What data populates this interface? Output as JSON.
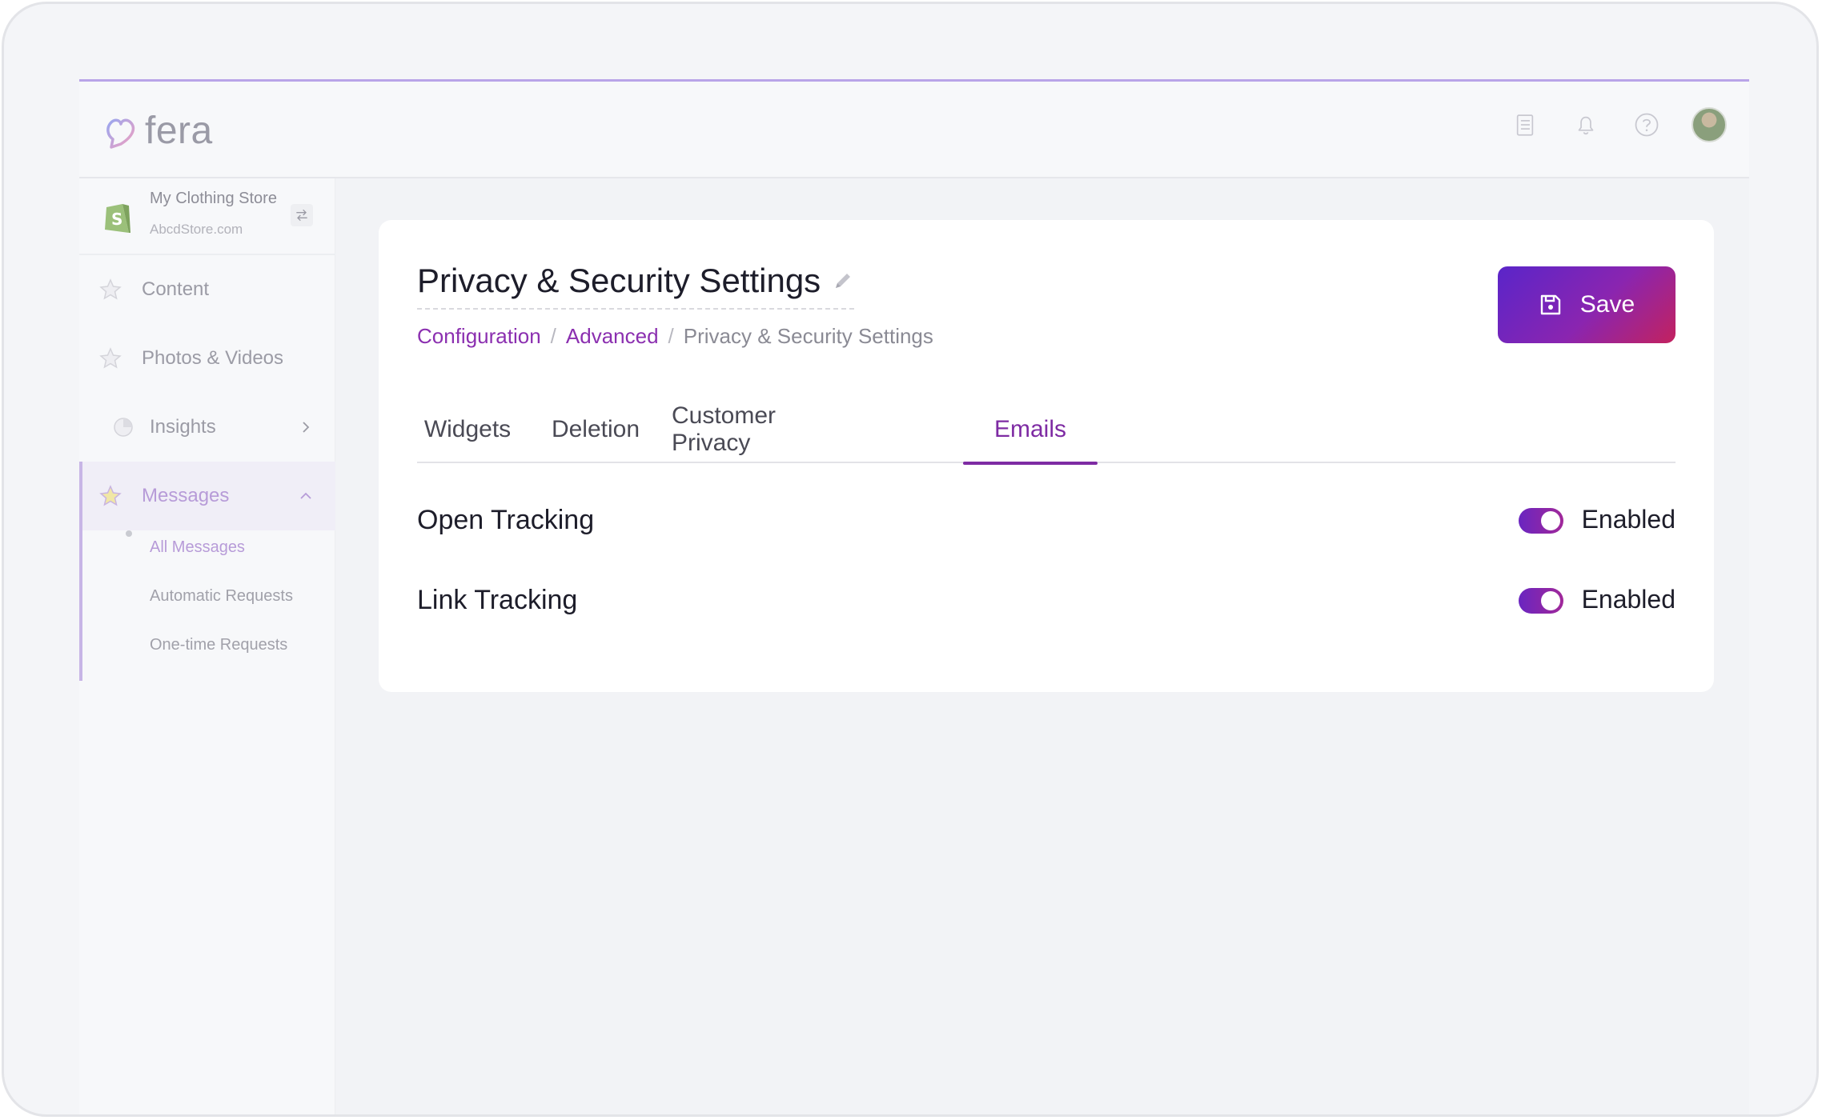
{
  "brand": {
    "name": "fera",
    "accent": "#8b2fb0"
  },
  "header": {
    "icons": [
      "clipboard-icon",
      "bell-icon",
      "help-icon",
      "avatar"
    ]
  },
  "sidebar": {
    "store": {
      "name": "My Clothing Store",
      "url": "AbcdStore.com"
    },
    "items": [
      {
        "label": "Content",
        "icon": "star-icon"
      },
      {
        "label": "Photos & Videos",
        "icon": "star-icon"
      },
      {
        "label": "Insights",
        "icon": "chart-icon"
      },
      {
        "label": "Messages",
        "icon": "star-icon"
      }
    ],
    "sub_items": [
      {
        "label": "All Messages"
      },
      {
        "label": "Automatic Requests"
      },
      {
        "label": "One-time Requests"
      }
    ]
  },
  "page": {
    "title": "Privacy & Security Settings",
    "breadcrumb": [
      "Configuration",
      "Advanced",
      "Privacy & Security Settings"
    ],
    "breadcrumb_sep": "/",
    "save_label": "Save"
  },
  "tabs": [
    {
      "label": "Widgets"
    },
    {
      "label": "Deletion"
    },
    {
      "label": "Customer Privacy"
    },
    {
      "label": "Emails"
    }
  ],
  "settings": [
    {
      "label": "Open Tracking",
      "state": "Enabled"
    },
    {
      "label": "Link Tracking",
      "state": "Enabled"
    }
  ]
}
